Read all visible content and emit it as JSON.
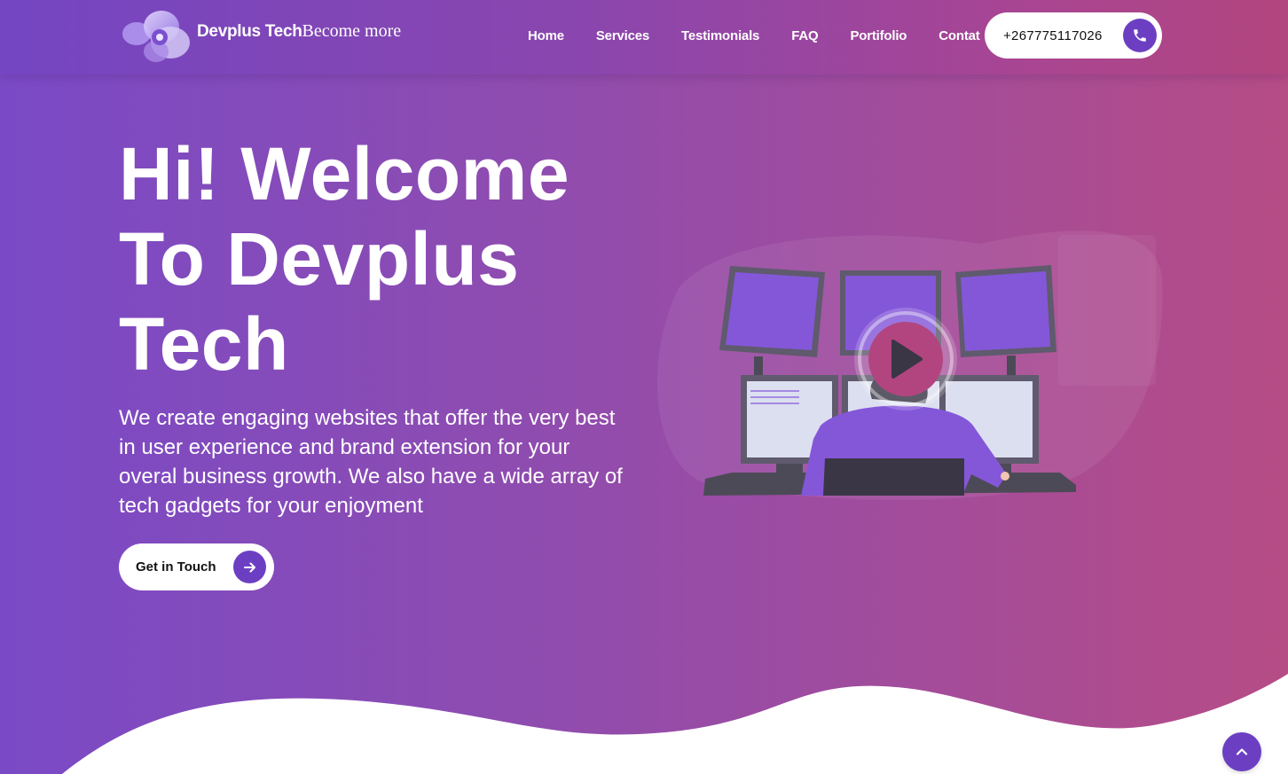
{
  "brand": {
    "name": "Devplus Tech",
    "tagline": "Become more"
  },
  "nav": {
    "items": [
      {
        "label": "Home"
      },
      {
        "label": "Services"
      },
      {
        "label": "Testimonials"
      },
      {
        "label": "FAQ"
      },
      {
        "label": "Portifolio"
      },
      {
        "label": "Contat"
      }
    ]
  },
  "header": {
    "phone": "+267775117026",
    "phone_icon": "phone-icon"
  },
  "hero": {
    "title": "Hi! Welcome To Devplus Tech",
    "description": "We create engaging websites that offer the very best in user experience and brand extension for your overal business growth. We also have a wide array of tech gadgets for your enjoyment",
    "cta_label": "Get in Touch",
    "cta_icon": "arrow-right-icon",
    "video_icon": "play-icon"
  },
  "scroll_top_icon": "chevron-up-icon",
  "colors": {
    "accent": "#6c3fc2",
    "play": "#b2457f",
    "gradient_start": "#7a4ac6",
    "gradient_end": "#b64c86"
  }
}
